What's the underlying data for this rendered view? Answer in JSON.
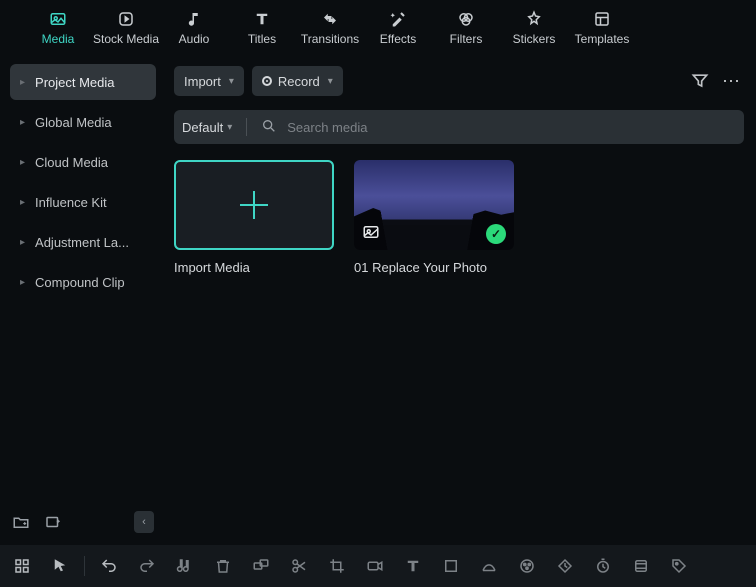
{
  "tabs": [
    {
      "id": "media",
      "label": "Media"
    },
    {
      "id": "stock",
      "label": "Stock Media"
    },
    {
      "id": "audio",
      "label": "Audio"
    },
    {
      "id": "titles",
      "label": "Titles"
    },
    {
      "id": "transitions",
      "label": "Transitions"
    },
    {
      "id": "effects",
      "label": "Effects"
    },
    {
      "id": "filters",
      "label": "Filters"
    },
    {
      "id": "stickers",
      "label": "Stickers"
    },
    {
      "id": "templates",
      "label": "Templates"
    }
  ],
  "sidebar": {
    "items": [
      {
        "label": "Project Media"
      },
      {
        "label": "Global Media"
      },
      {
        "label": "Cloud Media"
      },
      {
        "label": "Influence Kit"
      },
      {
        "label": "Adjustment La..."
      },
      {
        "label": "Compound Clip"
      }
    ]
  },
  "buttons": {
    "import": "Import",
    "record": "Record"
  },
  "search": {
    "default_label": "Default",
    "placeholder": "Search media"
  },
  "cards": {
    "import": "Import Media",
    "item1": "01 Replace Your Photo"
  }
}
